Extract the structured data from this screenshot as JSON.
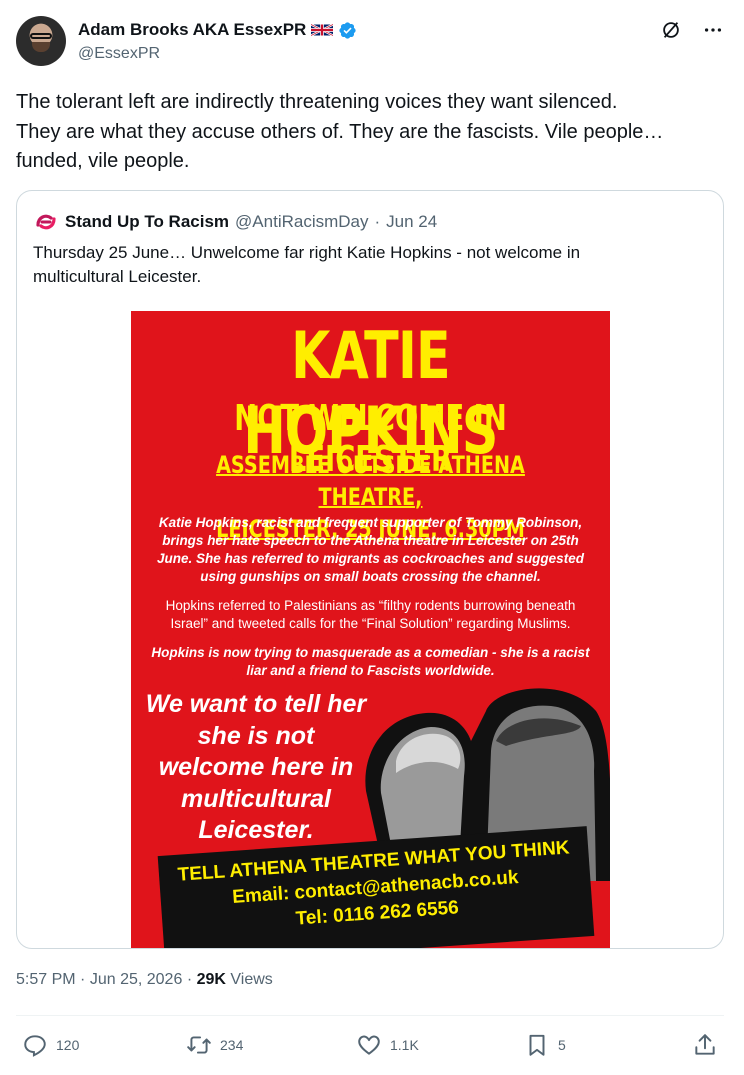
{
  "author": {
    "display_name": "Adam Brooks AKA EssexPR",
    "handle": "@EssexPR"
  },
  "icons": {
    "avatar": "avatar",
    "flag": "uk-flag-icon",
    "verified": "verified-badge-icon",
    "grok": "grok-icon",
    "more": "more-icon"
  },
  "tweet": {
    "text_lines": [
      "The tolerant left are indirectly threatening voices they want silenced.",
      "They are what they accuse others of. They are the fascists. Vile people…",
      "funded, vile people."
    ]
  },
  "quote": {
    "account_name": "Stand Up To Racism",
    "handle": "@AntiRacismDay",
    "separator": "·",
    "date": "Jun 24",
    "text_lines": [
      "Thursday 25 June… Unwelcome far right Katie Hopkins - not welcome in",
      "multicultural Leicester."
    ],
    "poster": {
      "title": "KATIE HOPKINS",
      "subtitle": "NOT WELCOME IN LEICESTER",
      "assemble_line1": "ASSEMBLE OUTSIDE ATHENA THEATRE,",
      "assemble_line2": "LEICESTER, 25 JUNE, 6.30PM",
      "para1": "Katie Hopkins, racist and frequent supporter of Tommy Robinson, brings her hate speech to the Athena theatre in Leicester on 25th June. She has referred to migrants as cockroaches and suggested using gunships on small boats crossing the channel.",
      "para2": "Hopkins referred to Palestinians as “filthy rodents burrowing beneath Israel” and tweeted calls for the “Final Solution” regarding Muslims.",
      "para3": "Hopkins is now trying to masquerade as a comedian - she is a racist liar and a friend to Fascists worldwide.",
      "want_lines": [
        "We want to tell her",
        "she is not",
        "welcome here in",
        "multicultural",
        "Leicester."
      ],
      "box_line1": "TELL ATHENA THEATRE WHAT YOU THINK",
      "box_line2": "Email: contact@athenacb.co.uk",
      "box_line3": "Tel: 0116 262 6556"
    }
  },
  "meta": {
    "time": "5:57 PM",
    "sep1": "·",
    "date": "Jun 25, 2026",
    "sep2": "·",
    "views_count": "29K",
    "views_label": "Views"
  },
  "actions": {
    "replies": "120",
    "reposts": "234",
    "likes": "1.1K",
    "bookmarks": "5"
  }
}
